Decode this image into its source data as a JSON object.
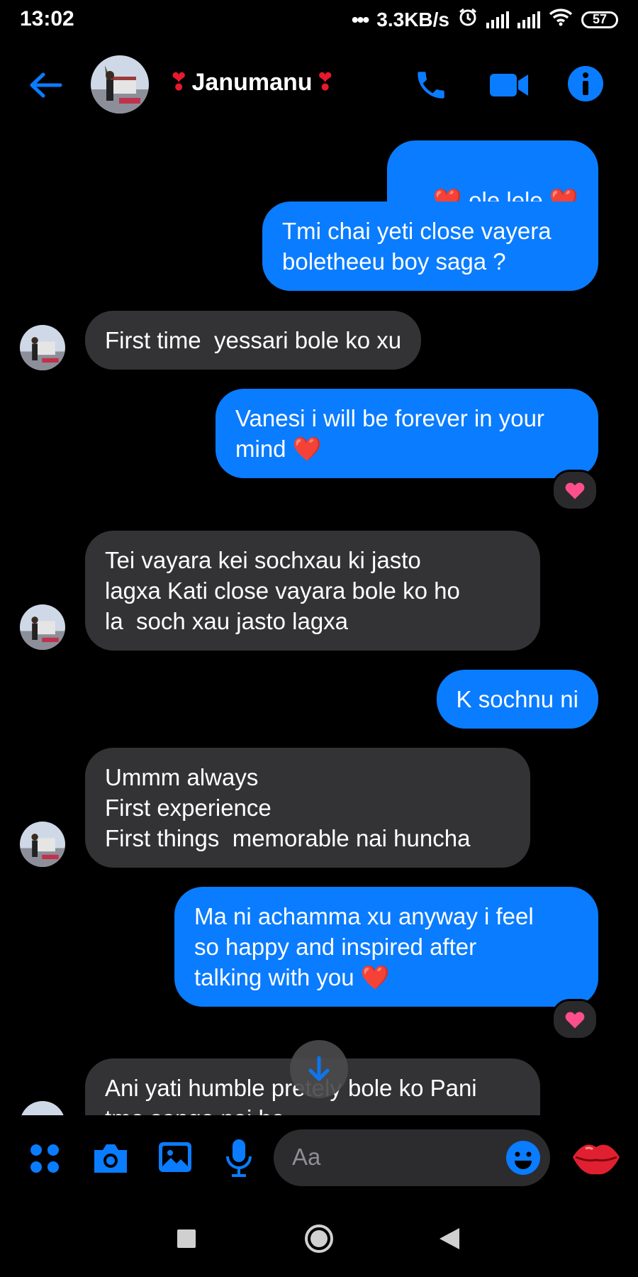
{
  "status_bar": {
    "time": "13:02",
    "network_speed": "3.3KB/s",
    "battery": "57",
    "icons": [
      "alarm-icon",
      "signal-icon",
      "signal-icon",
      "wifi-icon",
      "battery-icon"
    ]
  },
  "header": {
    "contact_name": "Janumanu",
    "name_decoration": "❣",
    "icons": [
      "back-arrow-icon",
      "phone-icon",
      "video-call-icon",
      "info-icon"
    ]
  },
  "messages": [
    {
      "direction": "outgoing",
      "text": " ole lele "
    },
    {
      "direction": "outgoing",
      "text": "Tmi chai yeti close vayera\nboletheeu boy saga ?"
    },
    {
      "direction": "incoming",
      "text": "First time  yessari bole ko xu"
    },
    {
      "direction": "outgoing",
      "text": "Vanesi i will be forever in your\nmind ",
      "reaction": "heart"
    },
    {
      "direction": "incoming",
      "text": "Tei vayara kei sochxau ki jasto\nlagxa Kati close vayara bole ko ho\nla  soch xau jasto lagxa"
    },
    {
      "direction": "outgoing",
      "text": "K sochnu ni"
    },
    {
      "direction": "incoming",
      "text": "Ummm always\nFirst experience\nFirst things  memorable nai huncha"
    },
    {
      "direction": "outgoing",
      "text": "Ma ni achamma xu anyway i feel\nso happy and inspired after\ntalking with you ",
      "reaction": "heart"
    },
    {
      "direction": "incoming",
      "text": "Ani yati humble pretely bole ko Pani\ntmo sanga nai ho"
    }
  ],
  "composer": {
    "placeholder": "Aa",
    "icons": [
      "apps-icon",
      "camera-icon",
      "gallery-icon",
      "microphone-icon",
      "emoji-icon",
      "lips-icon"
    ]
  },
  "nav_bar": {
    "icons": [
      "recents-icon",
      "home-icon",
      "back-icon"
    ]
  },
  "colors": {
    "accent": "#0a7cff",
    "incoming_bubble": "#333335",
    "background": "#000000",
    "heart": "#e8192c",
    "reaction_heart": "#ff4f8b"
  }
}
